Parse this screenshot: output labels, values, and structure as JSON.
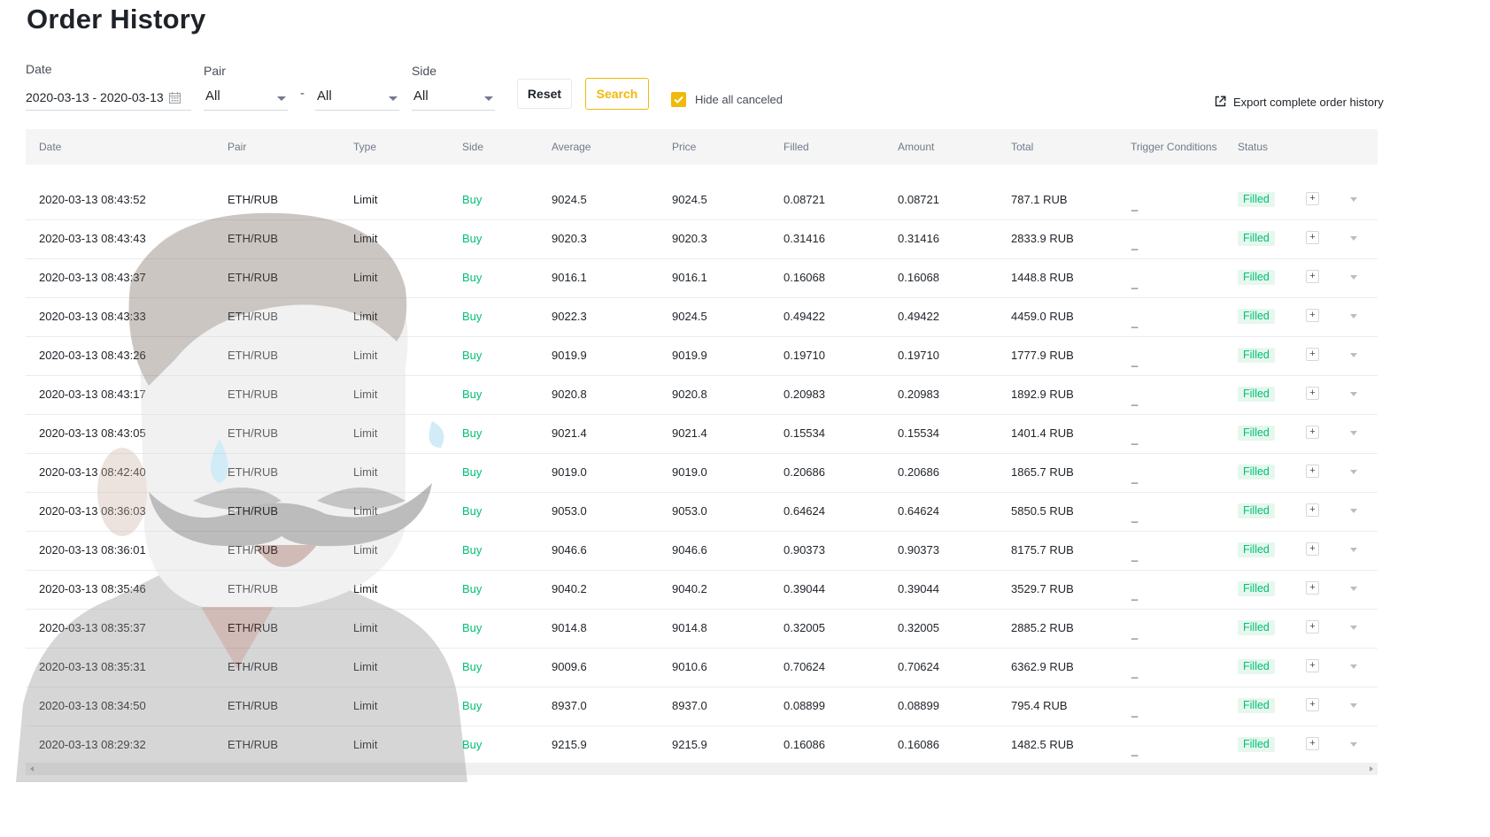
{
  "page_title": "Order History",
  "filters": {
    "date_label": "Date",
    "date_range": "2020-03-13 - 2020-03-13",
    "pair_label": "Pair",
    "pair_base": "All",
    "pair_separator": "-",
    "pair_quote": "All",
    "side_label": "Side",
    "side_value": "All",
    "reset_label": "Reset",
    "search_label": "Search",
    "hide_canceled_label": "Hide all canceled",
    "hide_canceled_checked": true,
    "export_label": "Export complete order history"
  },
  "colors": {
    "accent": "#f0b90b",
    "buy": "#02c076",
    "badge_bg": "#e6f7ee"
  },
  "table": {
    "headers": [
      "Date",
      "Pair",
      "Type",
      "Side",
      "Average",
      "Price",
      "Filled",
      "Amount",
      "Total",
      "Trigger Conditions",
      "Status"
    ],
    "rows": [
      {
        "date": "2020-03-13 08:43:52",
        "pair": "ETH/RUB",
        "type": "Limit",
        "side": "Buy",
        "average": "9024.5",
        "price": "9024.5",
        "filled": "0.08721",
        "amount": "0.08721",
        "total": "787.1 RUB",
        "trigger": "_",
        "status": "Filled"
      },
      {
        "date": "2020-03-13 08:43:43",
        "pair": "ETH/RUB",
        "type": "Limit",
        "side": "Buy",
        "average": "9020.3",
        "price": "9020.3",
        "filled": "0.31416",
        "amount": "0.31416",
        "total": "2833.9 RUB",
        "trigger": "_",
        "status": "Filled"
      },
      {
        "date": "2020-03-13 08:43:37",
        "pair": "ETH/RUB",
        "type": "Limit",
        "side": "Buy",
        "average": "9016.1",
        "price": "9016.1",
        "filled": "0.16068",
        "amount": "0.16068",
        "total": "1448.8 RUB",
        "trigger": "_",
        "status": "Filled"
      },
      {
        "date": "2020-03-13 08:43:33",
        "pair": "ETH/RUB",
        "type": "Limit",
        "side": "Buy",
        "average": "9022.3",
        "price": "9024.5",
        "filled": "0.49422",
        "amount": "0.49422",
        "total": "4459.0 RUB",
        "trigger": "_",
        "status": "Filled"
      },
      {
        "date": "2020-03-13 08:43:26",
        "pair": "ETH/RUB",
        "type": "Limit",
        "side": "Buy",
        "average": "9019.9",
        "price": "9019.9",
        "filled": "0.19710",
        "amount": "0.19710",
        "total": "1777.9 RUB",
        "trigger": "_",
        "status": "Filled"
      },
      {
        "date": "2020-03-13 08:43:17",
        "pair": "ETH/RUB",
        "type": "Limit",
        "side": "Buy",
        "average": "9020.8",
        "price": "9020.8",
        "filled": "0.20983",
        "amount": "0.20983",
        "total": "1892.9 RUB",
        "trigger": "_",
        "status": "Filled"
      },
      {
        "date": "2020-03-13 08:43:05",
        "pair": "ETH/RUB",
        "type": "Limit",
        "side": "Buy",
        "average": "9021.4",
        "price": "9021.4",
        "filled": "0.15534",
        "amount": "0.15534",
        "total": "1401.4 RUB",
        "trigger": "_",
        "status": "Filled"
      },
      {
        "date": "2020-03-13 08:42:40",
        "pair": "ETH/RUB",
        "type": "Limit",
        "side": "Buy",
        "average": "9019.0",
        "price": "9019.0",
        "filled": "0.20686",
        "amount": "0.20686",
        "total": "1865.7 RUB",
        "trigger": "_",
        "status": "Filled"
      },
      {
        "date": "2020-03-13 08:36:03",
        "pair": "ETH/RUB",
        "type": "Limit",
        "side": "Buy",
        "average": "9053.0",
        "price": "9053.0",
        "filled": "0.64624",
        "amount": "0.64624",
        "total": "5850.5 RUB",
        "trigger": "_",
        "status": "Filled"
      },
      {
        "date": "2020-03-13 08:36:01",
        "pair": "ETH/RUB",
        "type": "Limit",
        "side": "Buy",
        "average": "9046.6",
        "price": "9046.6",
        "filled": "0.90373",
        "amount": "0.90373",
        "total": "8175.7 RUB",
        "trigger": "_",
        "status": "Filled"
      },
      {
        "date": "2020-03-13 08:35:46",
        "pair": "ETH/RUB",
        "type": "Limit",
        "side": "Buy",
        "average": "9040.2",
        "price": "9040.2",
        "filled": "0.39044",
        "amount": "0.39044",
        "total": "3529.7 RUB",
        "trigger": "_",
        "status": "Filled"
      },
      {
        "date": "2020-03-13 08:35:37",
        "pair": "ETH/RUB",
        "type": "Limit",
        "side": "Buy",
        "average": "9014.8",
        "price": "9014.8",
        "filled": "0.32005",
        "amount": "0.32005",
        "total": "2885.2 RUB",
        "trigger": "_",
        "status": "Filled"
      },
      {
        "date": "2020-03-13 08:35:31",
        "pair": "ETH/RUB",
        "type": "Limit",
        "side": "Buy",
        "average": "9009.6",
        "price": "9010.6",
        "filled": "0.70624",
        "amount": "0.70624",
        "total": "6362.9 RUB",
        "trigger": "_",
        "status": "Filled"
      },
      {
        "date": "2020-03-13 08:34:50",
        "pair": "ETH/RUB",
        "type": "Limit",
        "side": "Buy",
        "average": "8937.0",
        "price": "8937.0",
        "filled": "0.08899",
        "amount": "0.08899",
        "total": "795.4 RUB",
        "trigger": "_",
        "status": "Filled"
      },
      {
        "date": "2020-03-13 08:29:32",
        "pair": "ETH/RUB",
        "type": "Limit",
        "side": "Buy",
        "average": "9215.9",
        "price": "9215.9",
        "filled": "0.16086",
        "amount": "0.16086",
        "total": "1482.5 RUB",
        "trigger": "_",
        "status": "Filled"
      }
    ],
    "expand_label": "+"
  },
  "icons": {
    "calendar": "calendar-icon",
    "export": "external-link-icon",
    "check": "checkmark-icon",
    "row_expand": "plus-icon",
    "row_caret": "chevron-down-icon"
  }
}
